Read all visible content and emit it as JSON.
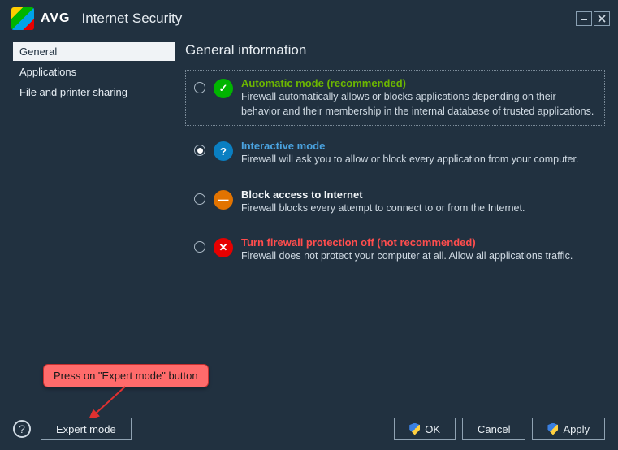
{
  "titlebar": {
    "brand": "AVG",
    "product": "Internet Security"
  },
  "sidebar": {
    "items": [
      {
        "label": "General",
        "selected": true
      },
      {
        "label": "Applications",
        "selected": false
      },
      {
        "label": "File and printer sharing",
        "selected": false
      }
    ]
  },
  "main": {
    "heading": "General information",
    "options": [
      {
        "title": "Automatic mode (recommended)",
        "desc": "Firewall automatically allows or blocks applications depending on their behavior and their membership in the internal database of trusted applications.",
        "checked": false,
        "selected": true,
        "icon_name": "checkmark-icon",
        "icon_glyph": "✓",
        "icon_class": "ic-green",
        "title_class": "t-green"
      },
      {
        "title": "Interactive mode",
        "desc": "Firewall will ask you to allow or block every application from your computer.",
        "checked": true,
        "selected": false,
        "icon_name": "question-icon",
        "icon_glyph": "?",
        "icon_class": "ic-blue",
        "title_class": "t-blue"
      },
      {
        "title": "Block access to Internet",
        "desc": "Firewall blocks every attempt to connect to or from the Internet.",
        "checked": false,
        "selected": false,
        "icon_name": "block-icon",
        "icon_glyph": "—",
        "icon_class": "ic-orange",
        "title_class": "t-white"
      },
      {
        "title": "Turn firewall protection off (not recommended)",
        "desc": "Firewall does not protect your computer at all. Allow all applications traffic.",
        "checked": false,
        "selected": false,
        "icon_name": "cross-icon",
        "icon_glyph": "✕",
        "icon_class": "ic-red",
        "title_class": "t-red"
      }
    ]
  },
  "footer": {
    "expert_label": "Expert mode",
    "ok_label": "OK",
    "cancel_label": "Cancel",
    "apply_label": "Apply"
  },
  "callout": {
    "text": "Press on \"Expert mode\" button"
  }
}
